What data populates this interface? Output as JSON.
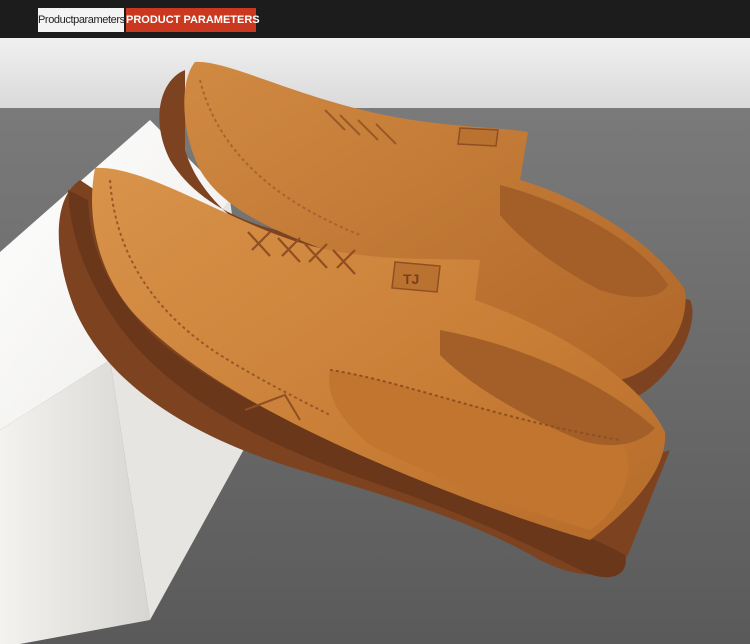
{
  "header": {
    "label_en": "Productparameters",
    "label_caps": "PRODUCT PARAMETERS",
    "bar_color": "#1c1c1c",
    "accent_color": "#c9381f"
  },
  "photo": {
    "subject": "Pair of tan leather slip-on loafers resting on a white block",
    "insole_logo": "TJ",
    "shoe_color": "#d08a3f",
    "sole_color": "#8a4a22",
    "background_color": "#6b6b6b"
  }
}
